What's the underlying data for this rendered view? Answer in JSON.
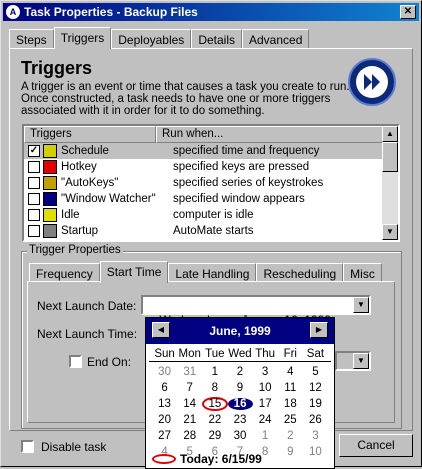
{
  "window": {
    "title": "Task Properties - Backup Files",
    "icon_letter": "A"
  },
  "main_tabs": [
    "Steps",
    "Triggers",
    "Deployables",
    "Details",
    "Advanced"
  ],
  "section": {
    "heading": "Triggers",
    "description": "A trigger is an event or time that causes a task you create to run. Once constructed, a task needs to have one or more triggers associated with it in order for it to do something."
  },
  "trigger_list": {
    "columns": [
      "Triggers",
      "Run when..."
    ],
    "rows": [
      {
        "name": "Schedule",
        "when": "specified time and frequency",
        "checked": true,
        "icon": "clock-icon"
      },
      {
        "name": "Hotkey",
        "when": "specified keys are pressed",
        "checked": false,
        "icon": "hotkey-icon"
      },
      {
        "name": "\"AutoKeys\"",
        "when": "specified series of keystrokes",
        "checked": false,
        "icon": "autokeys-icon"
      },
      {
        "name": "\"Window Watcher\"",
        "when": "specified window appears",
        "checked": false,
        "icon": "window-icon"
      },
      {
        "name": "Idle",
        "when": "computer is idle",
        "checked": false,
        "icon": "monitor-icon"
      },
      {
        "name": "Startup",
        "when": "AutoMate starts",
        "checked": false,
        "icon": "startup-icon"
      }
    ]
  },
  "trigger_properties": {
    "label": "Trigger Properties",
    "tabs": [
      "Frequency",
      "Start Time",
      "Late Handling",
      "Rescheduling",
      "Misc"
    ],
    "next_launch_date_label": "Next Launch Date:",
    "next_launch_date_value": "Wednesday,     June     16, 1999",
    "next_launch_time_label": "Next Launch Time:",
    "end_on_label": "End On:"
  },
  "calendar": {
    "month_title": "June, 1999",
    "weekdays": [
      "Sun",
      "Mon",
      "Tue",
      "Wed",
      "Thu",
      "Fri",
      "Sat"
    ],
    "weeks": [
      [
        "30",
        "31",
        "1",
        "2",
        "3",
        "4",
        "5"
      ],
      [
        "6",
        "7",
        "8",
        "9",
        "10",
        "11",
        "12"
      ],
      [
        "13",
        "14",
        "15",
        "16",
        "17",
        "18",
        "19"
      ],
      [
        "20",
        "21",
        "22",
        "23",
        "24",
        "25",
        "26"
      ],
      [
        "27",
        "28",
        "29",
        "30",
        "1",
        "2",
        "3"
      ],
      [
        "4",
        "5",
        "6",
        "7",
        "8",
        "9",
        "10"
      ]
    ],
    "today_text": "Today: 6/15/99",
    "selected_day": "16",
    "today_day": "15"
  },
  "footer": {
    "disable_task_label": "Disable task",
    "cancel_label": "Cancel"
  },
  "colors": {
    "title_bar": "#000080",
    "selection": "#000080",
    "today_ring": "#e00000"
  }
}
